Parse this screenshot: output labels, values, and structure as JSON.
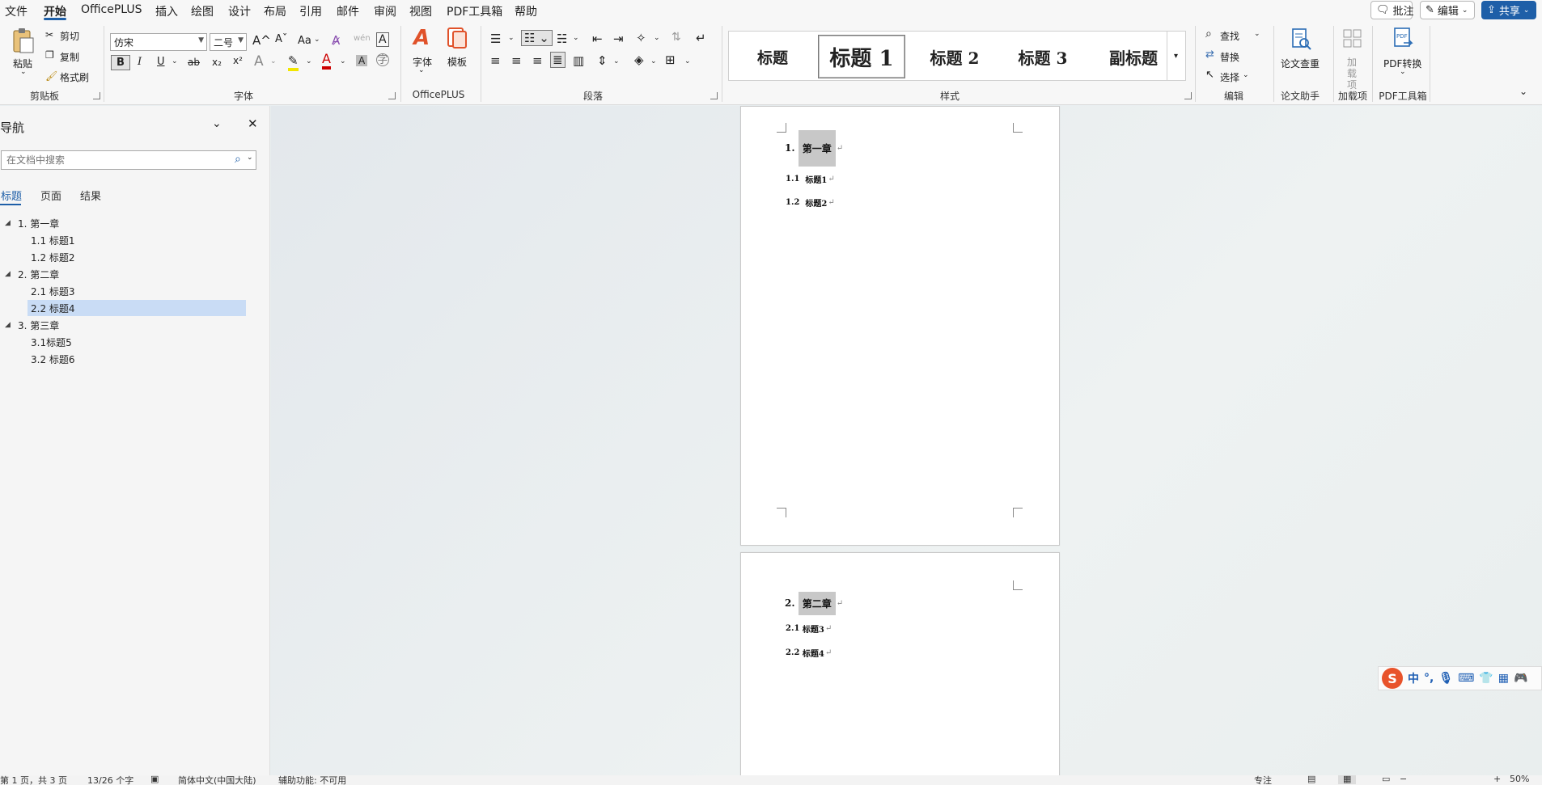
{
  "menu": {
    "items": [
      "文件",
      "开始",
      "OfficePLUS",
      "插入",
      "绘图",
      "设计",
      "布局",
      "引用",
      "邮件",
      "审阅",
      "视图",
      "PDF工具箱",
      "帮助"
    ],
    "active_index": 1,
    "comment_btn": "批注",
    "edit_btn": "编辑",
    "share_btn": "共享"
  },
  "ribbon": {
    "clipboard": {
      "paste": "粘贴",
      "cut": "剪切",
      "copy": "复制",
      "format_painter": "格式刷",
      "label": "剪贴板"
    },
    "font": {
      "name": "仿宋",
      "size": "二号",
      "case": "Aa",
      "bold": "B",
      "italic": "I",
      "underline": "U",
      "strike": "ab",
      "sub": "x₂",
      "sup": "x²",
      "label": "字体"
    },
    "officeplus": {
      "font": "字体",
      "template": "模板",
      "label": "OfficePLUS"
    },
    "paragraph": {
      "label": "段落"
    },
    "styles": {
      "items": [
        "标题",
        "标题 1",
        "标题 2",
        "标题 3",
        "副标题"
      ],
      "selected_index": 1,
      "label": "样式"
    },
    "editing": {
      "find": "查找",
      "replace": "替换",
      "select": "选择",
      "label": "编辑"
    },
    "paper_check": {
      "button": "论文查重",
      "label": "论文助手"
    },
    "addins": {
      "button": "加载项",
      "label": "加载项"
    },
    "pdf": {
      "button": "PDF转换",
      "label": "PDF工具箱"
    }
  },
  "nav": {
    "title": "导航",
    "search_placeholder": "在文档中搜索",
    "tabs": [
      "标题",
      "页面",
      "结果"
    ],
    "active_tab": 0,
    "tree": [
      {
        "level": 1,
        "text": "1. 第一章",
        "expanded": true
      },
      {
        "level": 2,
        "text": "1.1 标题1"
      },
      {
        "level": 2,
        "text": "1.2 标题2"
      },
      {
        "level": 1,
        "text": "2. 第二章",
        "expanded": true
      },
      {
        "level": 2,
        "text": "2.1 标题3"
      },
      {
        "level": 2,
        "text": "2.2 标题4",
        "selected": true
      },
      {
        "level": 1,
        "text": "3. 第三章",
        "expanded": true
      },
      {
        "level": 2,
        "text": "3.1标题5"
      },
      {
        "level": 2,
        "text": "3.2 标题6"
      }
    ]
  },
  "document": {
    "pages": [
      {
        "lines": [
          {
            "num": "1.",
            "text": "第一章",
            "kind": "h1"
          },
          {
            "num": "1.1",
            "text": "标题1",
            "kind": "h2"
          },
          {
            "num": "1.2",
            "text": "标题2",
            "kind": "h2"
          }
        ]
      },
      {
        "lines": [
          {
            "num": "2.",
            "text": "第二章",
            "kind": "h1"
          },
          {
            "num": "2.1",
            "text": "标题3",
            "kind": "h2"
          },
          {
            "num": "2.2",
            "text": "标题4",
            "kind": "h2"
          }
        ]
      }
    ]
  },
  "ime": {
    "mode": "中"
  },
  "status": {
    "page": "第 1 页，共 3 页",
    "words": "13/26 个字",
    "language": "简体中文(中国大陆)",
    "accessibility": "辅助功能: 不可用",
    "focus": "专注",
    "zoom": "50%"
  }
}
